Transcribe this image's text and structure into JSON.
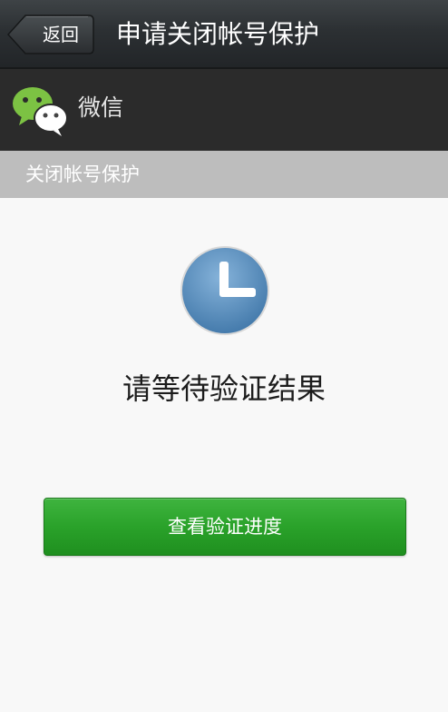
{
  "header": {
    "back_label": "返回",
    "title": "申请关闭帐号保护"
  },
  "account_bar": {
    "app_name": "微信",
    "logo_icon": "wechat-logo-icon"
  },
  "section": {
    "label": "关闭帐号保护"
  },
  "main": {
    "status_icon": "clock-icon",
    "status_text": "请等待验证结果",
    "progress_button_label": "查看验证进度"
  },
  "colors": {
    "topbar": "#2c3033",
    "account_bar": "#2b2b2b",
    "section_header": "#bdbdbd",
    "background": "#f8f8f8",
    "button_green": "#2aa22a",
    "clock_blue": "#5b8fbd"
  }
}
